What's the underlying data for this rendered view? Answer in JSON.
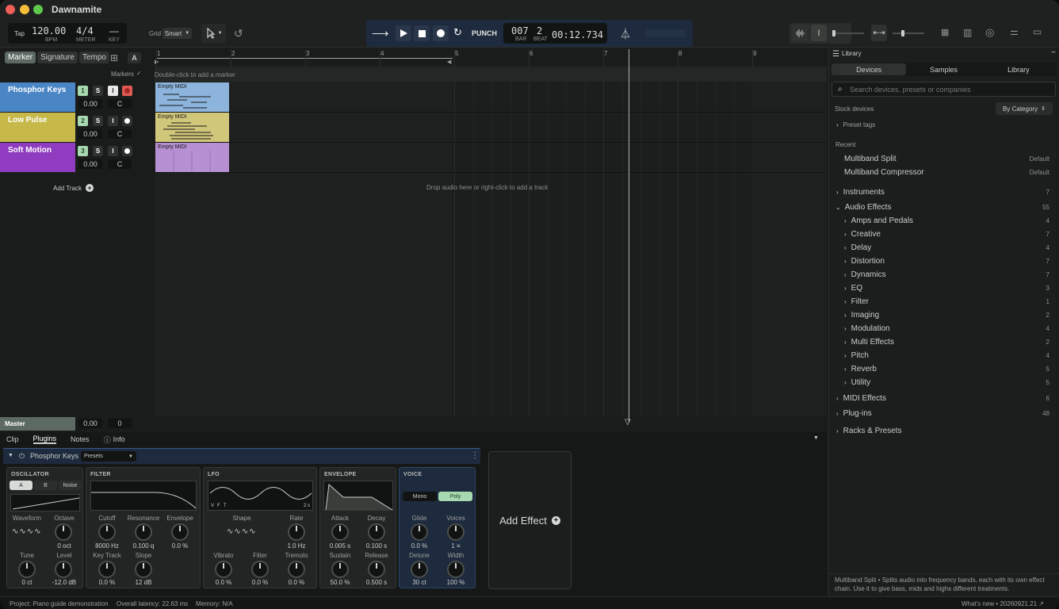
{
  "app": {
    "title": "Dawnamite"
  },
  "toolbar": {
    "tap": "Tap",
    "bpm": "120.00",
    "bpm_label": "BPM",
    "meter": "4/4",
    "meter_label": "METER",
    "key": "—",
    "key_label": "KEY",
    "grid_label": "Grid",
    "grid_value": "Smart"
  },
  "transport": {
    "punch": "PUNCH",
    "bar": "007",
    "bar_label": "BAR",
    "beat": "2",
    "beat_label": "BEAT",
    "time": "00:12.734"
  },
  "left_tabs": {
    "marker": "Marker",
    "signature": "Signature",
    "tempo": "Tempo",
    "a": "A"
  },
  "markers": {
    "label": "Markers",
    "hint": "Double-click to add a marker"
  },
  "ruler": [
    "1",
    "2",
    "3",
    "4",
    "5",
    "6",
    "7",
    "8",
    "9"
  ],
  "tracks": [
    {
      "name": "Phosphor Keys",
      "num": "1",
      "s": "S",
      "i": "I",
      "vol": "0.00",
      "pan": "C",
      "color": "#4a86c5",
      "clip_label": "Empty MIDI",
      "clip_color": "#8cb4dc"
    },
    {
      "name": "Low Pulse",
      "num": "2",
      "s": "S",
      "i": "I",
      "vol": "0.00",
      "pan": "C",
      "color": "#c6b94a",
      "clip_label": "Empty MIDI",
      "clip_color": "#d1c77a"
    },
    {
      "name": "Soft Motion",
      "num": "3",
      "s": "S",
      "i": "I",
      "vol": "0.00",
      "pan": "C",
      "color": "#8f3cc0",
      "clip_label": "Empty MIDI",
      "clip_color": "#b690d2"
    }
  ],
  "add_track": "Add Track",
  "drop_hint": "Drop audio here or right-click to add a track",
  "master": {
    "label": "Master",
    "vol": "0.00",
    "pan": "0"
  },
  "bottom_tabs": {
    "clip": "Clip",
    "plugins": "Plugins",
    "notes": "Notes",
    "info": "Info"
  },
  "plugin": {
    "name": "Phosphor Keys",
    "presets": "Presets",
    "oscillator": {
      "title": "OSCILLATOR",
      "a": "A",
      "b": "B",
      "noise": "Noise",
      "waveform": "Waveform",
      "octave": "Octave",
      "octave_val": "0 oct",
      "tune": "Tune",
      "tune_val": "0 ct",
      "level": "Level",
      "level_val": "-12.0 dB"
    },
    "filter": {
      "title": "FILTER",
      "cutoff": "Cutoff",
      "cutoff_val": "8000 Hz",
      "resonance": "Resonance",
      "resonance_val": "0.100 q",
      "envelope": "Envelope",
      "envelope_val": "0.0 %",
      "keytrack": "Key Track",
      "keytrack_val": "0.0 %",
      "slope": "Slope",
      "slope_val": "12 dB"
    },
    "lfo": {
      "title": "LFO",
      "v": "V",
      "f": "F",
      "t": "T",
      "rate_display": "2 s",
      "shape": "Shape",
      "rate": "Rate",
      "rate_val": "1.0 Hz",
      "vibrato": "Vibrato",
      "vibrato_val": "0.0 %",
      "filter": "Filter",
      "filter_val": "0.0 %",
      "tremolo": "Tremolo",
      "tremolo_val": "0.0 %"
    },
    "envelope": {
      "title": "ENVELOPE",
      "attack": "Attack",
      "attack_val": "0.005 s",
      "decay": "Decay",
      "decay_val": "0.100 s",
      "sustain": "Sustain",
      "sustain_val": "50.0 %",
      "release": "Release",
      "release_val": "0.500 s"
    },
    "voice": {
      "title": "VOICE",
      "mono": "Mono",
      "poly": "Poly",
      "glide": "Glide",
      "glide_val": "0.0 %",
      "voices": "Voices",
      "voices_val": "1 ≡",
      "detune": "Detune",
      "detune_val": "30 ct",
      "width": "Width",
      "width_val": "100 %"
    }
  },
  "add_effect": "Add Effect",
  "library": {
    "title": "Library",
    "tabs": [
      "Devices",
      "Samples",
      "Library"
    ],
    "search_placeholder": "Search devices, presets or companies",
    "stock": "Stock devices",
    "by_category": "By Category",
    "preset_tags": "Preset tags",
    "recent": "Recent",
    "recent_items": [
      {
        "name": "Multiband Split",
        "tag": "Default"
      },
      {
        "name": "Multiband Compressor",
        "tag": "Default"
      }
    ],
    "instruments": {
      "name": "Instruments",
      "count": "7"
    },
    "audio_effects": {
      "name": "Audio Effects",
      "count": "55"
    },
    "sub": [
      {
        "name": "Amps and Pedals",
        "count": "4"
      },
      {
        "name": "Creative",
        "count": "7"
      },
      {
        "name": "Delay",
        "count": "4"
      },
      {
        "name": "Distortion",
        "count": "7"
      },
      {
        "name": "Dynamics",
        "count": "7"
      },
      {
        "name": "EQ",
        "count": "3"
      },
      {
        "name": "Filter",
        "count": "1"
      },
      {
        "name": "Imaging",
        "count": "2"
      },
      {
        "name": "Modulation",
        "count": "4"
      },
      {
        "name": "Multi Effects",
        "count": "2"
      },
      {
        "name": "Pitch",
        "count": "4"
      },
      {
        "name": "Reverb",
        "count": "5"
      },
      {
        "name": "Utility",
        "count": "5"
      }
    ],
    "midi": {
      "name": "MIDI Effects",
      "count": "6"
    },
    "plugins": {
      "name": "Plug-ins",
      "count": "48"
    },
    "racks": {
      "name": "Racks & Presets"
    },
    "description": "Multiband Split • Splits audio into frequency bands, each with its own effect chain. Use it to give bass, mids and highs different treatments."
  },
  "status": {
    "project": "Project: Piano guide demonstration",
    "latency": "Overall latency: 22.63 ms",
    "memory": "Memory: N/A",
    "whats_new": "What's new • 20260921.21 ↗"
  }
}
